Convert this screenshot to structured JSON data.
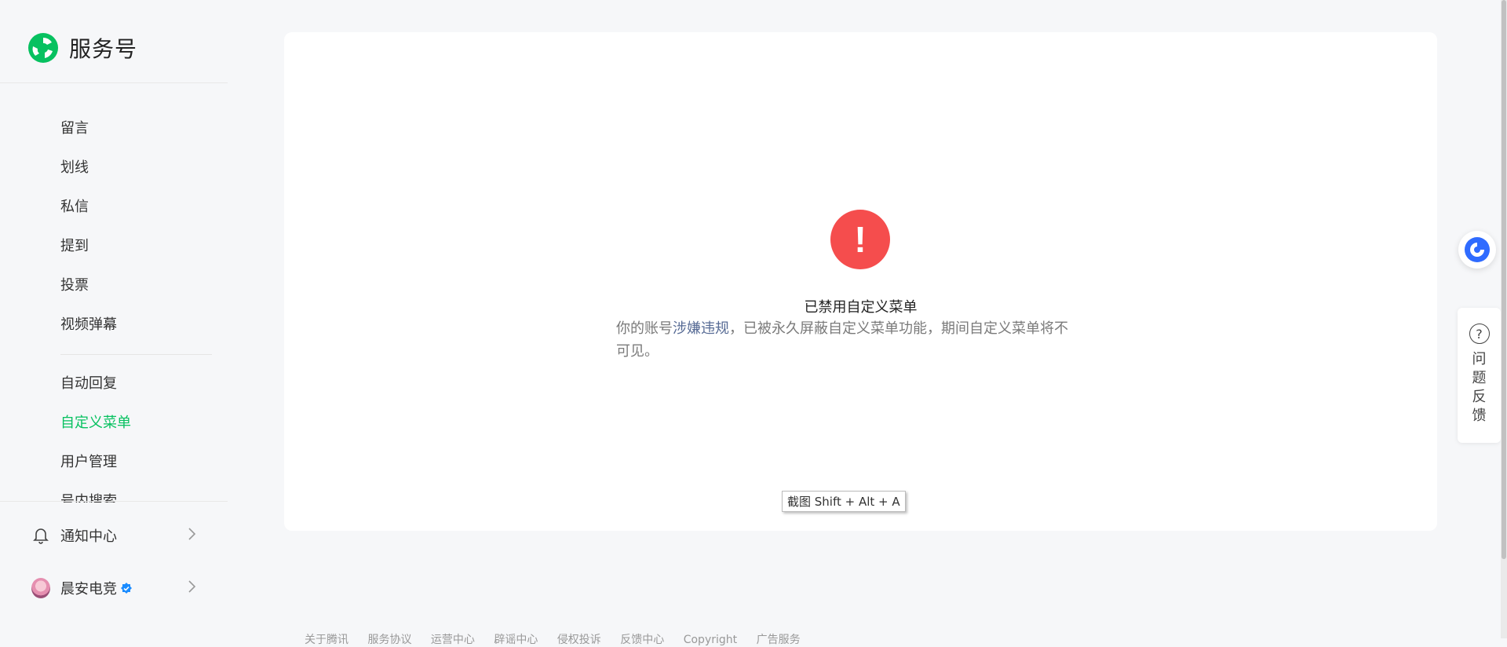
{
  "brand": {
    "title": "服务号"
  },
  "nav": {
    "items": [
      {
        "label": "留言",
        "active": false
      },
      {
        "label": "划线",
        "active": false
      },
      {
        "label": "私信",
        "active": false
      },
      {
        "label": "提到",
        "active": false
      },
      {
        "label": "投票",
        "active": false
      },
      {
        "label": "视频弹幕",
        "active": false
      },
      {
        "label": "自动回复",
        "active": false
      },
      {
        "label": "自定义菜单",
        "active": true
      },
      {
        "label": "用户管理",
        "active": false
      },
      {
        "label": "号内搜索",
        "active": false
      }
    ],
    "notification": "通知中心",
    "account_name": "晨安电竞"
  },
  "alert": {
    "title": "已禁用自定义菜单",
    "desc_prefix": "你的账号",
    "desc_link": "涉嫌违规",
    "desc_suffix": "，已被永久屏蔽自定义菜单功能，期间自定义菜单将不可见。"
  },
  "tooltip": {
    "text": "截图 Shift + Alt + A"
  },
  "feedback": {
    "label": "问题反馈"
  },
  "footer": {
    "links": [
      "关于腾讯",
      "服务协议",
      "运营中心",
      "辟谣中心",
      "侵权投诉",
      "反馈中心",
      "Copyright",
      "广告服务"
    ]
  },
  "colors": {
    "accent": "#07c160",
    "alert_red": "#f54d4d",
    "link_blue": "#576b95"
  }
}
